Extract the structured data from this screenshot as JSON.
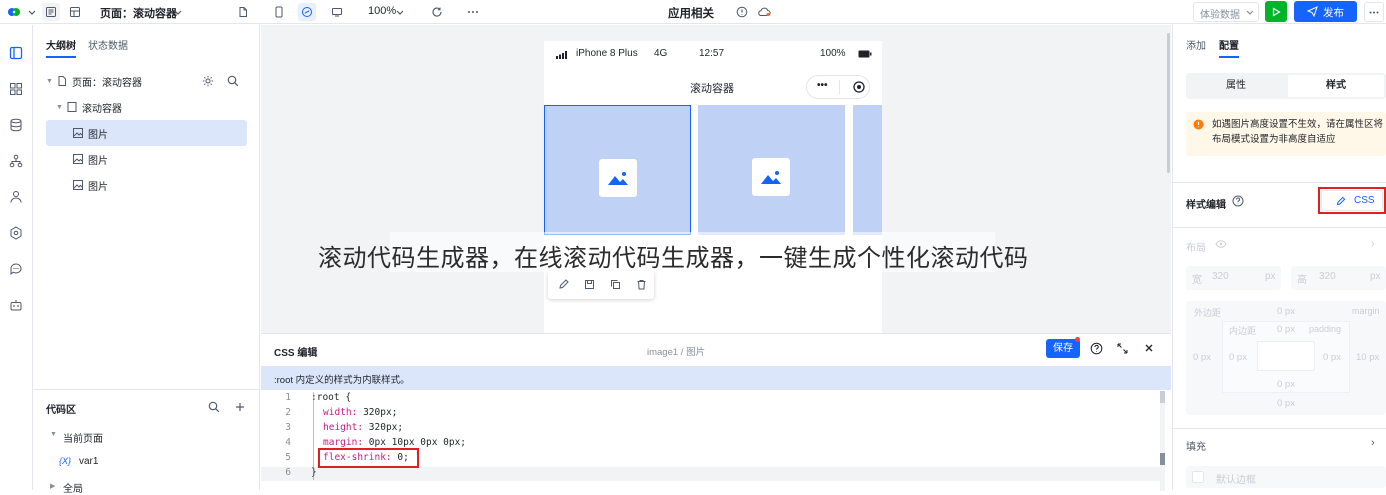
{
  "topbar": {
    "page_selector": "页面：滚动容器",
    "zoom": "100%",
    "app_title": "应用相关",
    "experience_data": "体验数据",
    "publish": "发布"
  },
  "left_panel": {
    "tabs": [
      "大纲树",
      "状态数据"
    ],
    "tree": [
      {
        "label": "页面：滚动容器"
      },
      {
        "label": "滚动容器"
      },
      {
        "label": "图片"
      },
      {
        "label": "图片"
      },
      {
        "label": "图片"
      }
    ],
    "code_area": {
      "title": "代码区",
      "current_page": "当前页面",
      "var_badge": "{X}",
      "var_name": "var1",
      "global": "全局"
    }
  },
  "phone": {
    "carrier": "iPhone 8 Plus",
    "network": "4G",
    "time": "12:57",
    "battery": "100%",
    "title": "滚动容器",
    "menu_dots": "•••"
  },
  "css_editor": {
    "title": "CSS 编辑",
    "breadcrumb": "image1 / 图片",
    "save": "保存",
    "note": ":root 内定义的样式为内联样式。",
    "lines": [
      {
        "num": "1",
        "text": ":root {"
      },
      {
        "num": "2",
        "prop": "width",
        "val": "320px;"
      },
      {
        "num": "3",
        "prop": "height",
        "val": "320px;"
      },
      {
        "num": "4",
        "prop": "margin",
        "val": "0px 10px 0px 0px;"
      },
      {
        "num": "5",
        "prop": "flex-shrink",
        "val": "0;"
      },
      {
        "num": "6",
        "text": "}"
      }
    ]
  },
  "right_panel": {
    "tabs": [
      "添加",
      "配置"
    ],
    "segments": [
      "属性",
      "样式"
    ],
    "notice": "如遇图片高度设置不生效，请在属性区将布局模式设置为非高度自适应",
    "style_edit": "样式编辑",
    "css_button": "CSS",
    "layout": "布局",
    "width_label": "宽",
    "width_value": "320",
    "height_label": "高",
    "height_value": "320",
    "unit": "px",
    "outer_label": "外边距",
    "inner_label": "内边距",
    "padding_label": "padding",
    "margin_en": "margin",
    "box_values": {
      "outer_top": "0 px",
      "outer_left": "0 px",
      "outer_right": "10 px",
      "outer_bottom": "0 px",
      "inner_top": "0 px",
      "inner_left": "0 px",
      "inner_right": "0 px",
      "inner_bottom": "0 px"
    },
    "fill": "填充",
    "default_border": "默认边框"
  },
  "caption": "滚动代码生成器，在线滚动代码生成器，一键生成个性化滚动代码",
  "colors": {
    "primary": "#1664ff",
    "green": "#00b42a",
    "highlight_red": "#e02020",
    "selection": "#dbe6fb",
    "image_fill": "#bfd2f5"
  }
}
